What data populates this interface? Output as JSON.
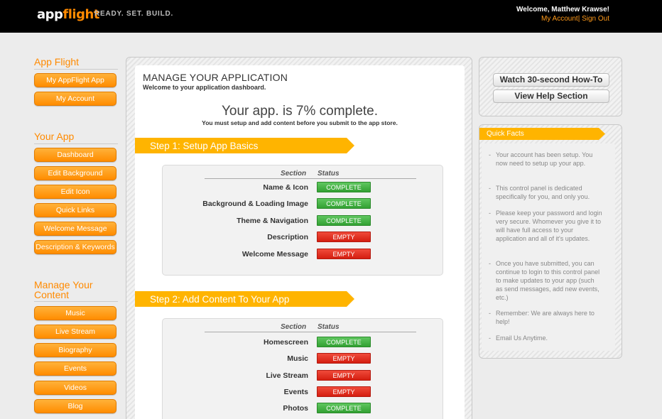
{
  "header": {
    "logo_part1": "app",
    "logo_part2": "flight",
    "tagline": "READY. SET. BUILD.",
    "welcome": "Welcome, Matthew Krawse!",
    "my_account": "My Account",
    "separator": "|",
    "sign_out": "Sign Out"
  },
  "sidebar": {
    "sections": [
      {
        "heading": "App Flight",
        "items": [
          "My AppFlight App",
          "My Account"
        ]
      },
      {
        "heading": "Your App",
        "items": [
          "Dashboard",
          "Edit Background",
          "Edit Icon",
          "Quick Links",
          "Welcome Message",
          "Description & Keywords"
        ]
      },
      {
        "heading_line1": "Manage Your",
        "heading_line2": "Content",
        "items": [
          "Music",
          "Live Stream",
          "Biography",
          "Events",
          "Videos",
          "Blog"
        ]
      }
    ]
  },
  "main": {
    "title": "MANAGE YOUR APPLICATION",
    "subtitle": "Welcome to your application dashboard.",
    "progress": "Your app. is 7% complete.",
    "progress_value": 0.07,
    "progress_note": "You must setup and add content before you submit to the app store.",
    "col_section": "Section",
    "col_status": "Status",
    "steps": [
      {
        "title": "Step 1: Setup App Basics",
        "rows": [
          {
            "section": "Name & Icon",
            "status": "COMPLETE"
          },
          {
            "section": "Background & Loading Image",
            "status": "COMPLETE"
          },
          {
            "section": "Theme & Navigation",
            "status": "COMPLETE"
          },
          {
            "section": "Description",
            "status": "EMPTY"
          },
          {
            "section": "Welcome Message",
            "status": "EMPTY"
          }
        ]
      },
      {
        "title": "Step 2: Add Content To Your App",
        "rows": [
          {
            "section": "Homescreen",
            "status": "COMPLETE"
          },
          {
            "section": "Music",
            "status": "EMPTY"
          },
          {
            "section": "Live Stream",
            "status": "EMPTY"
          },
          {
            "section": "Events",
            "status": "EMPTY"
          },
          {
            "section": "Photos",
            "status": "COMPLETE"
          }
        ]
      }
    ]
  },
  "right": {
    "help_buttons": [
      "Watch 30-second How-To",
      "View Help Section"
    ],
    "quick_facts_title": "Quick Facts",
    "facts": [
      "Your account has been setup. You now need to setup up your app.",
      "This control panel is dedicated specifically for you, and only you.",
      "Please keep your password and login very secure. Whomever you give it to will have full access to your application and all of it's updates.",
      "Once you have submitted, you can continue to login to this control panel to make updates to your app (such as send messages, add new events, etc.)",
      "Remember: We are always here to help!",
      "Email Us Anytime."
    ],
    "fact_dash": "-"
  },
  "colors": {
    "accent_orange": "#ff8a00",
    "complete_green": "#3fae3f",
    "empty_red": "#e0281a",
    "header_black": "#000000"
  }
}
